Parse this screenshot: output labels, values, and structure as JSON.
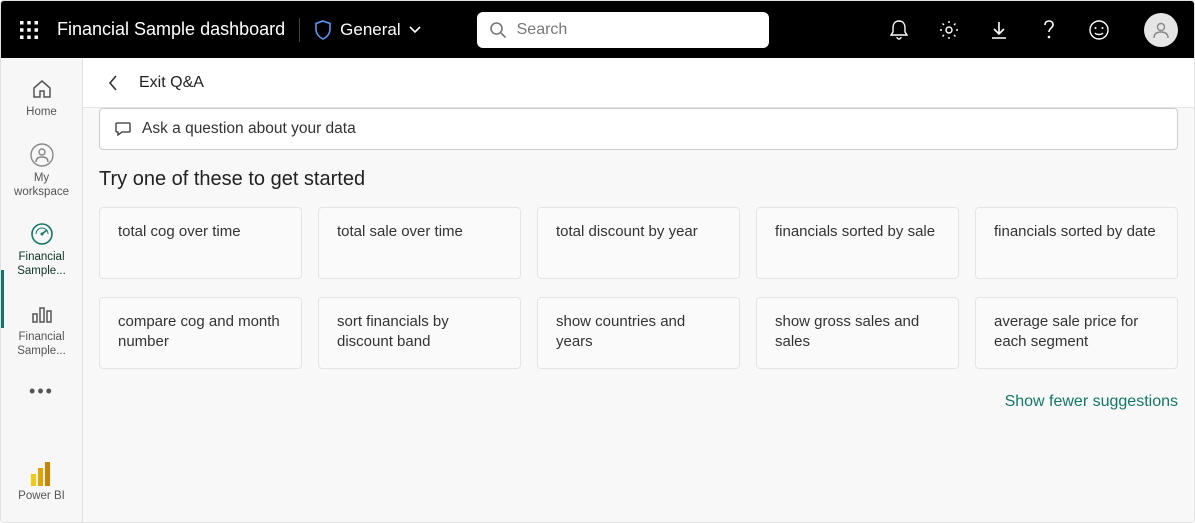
{
  "topbar": {
    "dashboard_title": "Financial Sample dashboard",
    "sensitivity_label": "General",
    "search_placeholder": "Search"
  },
  "leftrail": {
    "items": [
      {
        "label": "Home"
      },
      {
        "label": "My workspace"
      },
      {
        "label": "Financial Sample..."
      },
      {
        "label": "Financial Sample..."
      }
    ],
    "bottom_label": "Power BI"
  },
  "subheader": {
    "exit_label": "Exit Q&A"
  },
  "qa": {
    "input_placeholder": "Ask a question about your data",
    "section_title": "Try one of these to get started",
    "suggestions": [
      "total cog over time",
      "total sale over time",
      "total discount by year",
      "financials sorted by sale",
      "financials sorted by date",
      "compare cog and month number",
      "sort financials by discount band",
      "show countries and years",
      "show gross sales and sales",
      "average sale price for each segment"
    ],
    "show_fewer_label": "Show fewer suggestions"
  }
}
